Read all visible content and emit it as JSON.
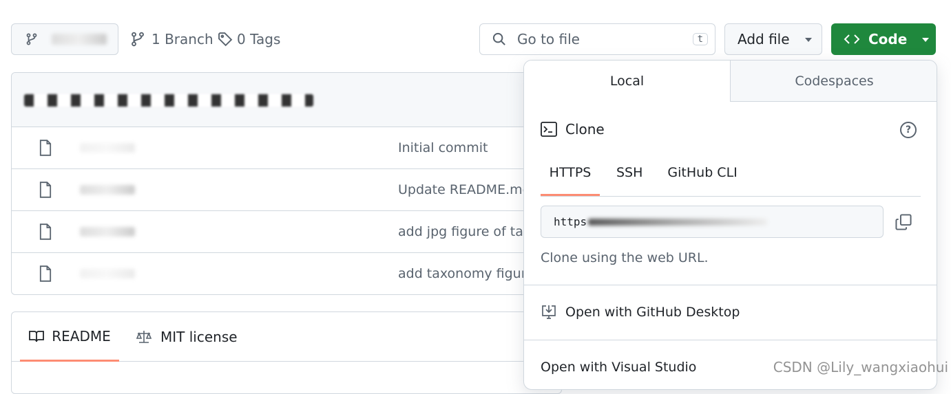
{
  "toolbar": {
    "branch_count": "1 Branch",
    "tag_count": "0 Tags",
    "search_placeholder": "Go to file",
    "search_shortcut": "t",
    "add_file": "Add file",
    "code": "Code"
  },
  "files": [
    {
      "message": "Initial commit"
    },
    {
      "message": "Update README.md"
    },
    {
      "message": "add jpg figure of taxonomy"
    },
    {
      "message": "add taxonomy figure"
    }
  ],
  "readme_tabs": {
    "readme": "README",
    "license": "MIT license"
  },
  "popover": {
    "tabs": [
      "Local",
      "Codespaces"
    ],
    "clone_title": "Clone",
    "protocols": [
      "HTTPS",
      "SSH",
      "GitHub CLI"
    ],
    "url_prefix": "https",
    "clone_hint": "Clone using the web URL.",
    "open_desktop": "Open with GitHub Desktop",
    "open_vs": "Open with Visual Studio"
  },
  "watermark": "CSDN @Lily_wangxiaohui",
  "colors": {
    "code_button": "#1f883d",
    "active_tab_underline": "#fd8c73"
  }
}
